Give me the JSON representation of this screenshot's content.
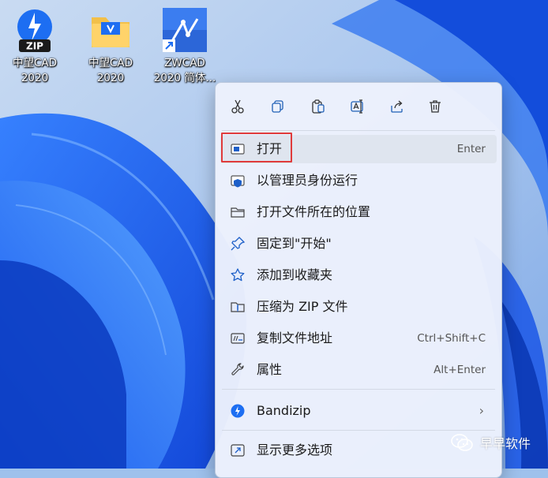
{
  "desktop": {
    "icons": [
      {
        "name": "zip-app",
        "label": "中望CAD\n2020"
      },
      {
        "name": "folder",
        "label": "中望CAD\n2020"
      },
      {
        "name": "zwcad-shortcut",
        "label": "ZWCAD\n2020 简体..."
      }
    ]
  },
  "context_menu": {
    "toolbar": [
      {
        "icon": "cut-icon"
      },
      {
        "icon": "copy-icon"
      },
      {
        "icon": "paste-icon"
      },
      {
        "icon": "rename-icon"
      },
      {
        "icon": "share-icon"
      },
      {
        "icon": "delete-icon"
      }
    ],
    "items": [
      {
        "label": "打开",
        "shortcut": "Enter",
        "icon": "open-window-icon"
      },
      {
        "label": "以管理员身份运行",
        "shortcut": "",
        "icon": "shield-icon"
      },
      {
        "label": "打开文件所在的位置",
        "shortcut": "",
        "icon": "folder-icon"
      },
      {
        "label": "固定到\"开始\"",
        "shortcut": "",
        "icon": "pin-icon"
      },
      {
        "label": "添加到收藏夹",
        "shortcut": "",
        "icon": "star-icon"
      },
      {
        "label": "压缩为 ZIP 文件",
        "shortcut": "",
        "icon": "zip-icon"
      },
      {
        "label": "复制文件地址",
        "shortcut": "Ctrl+Shift+C",
        "icon": "copy-path-icon"
      },
      {
        "label": "属性",
        "shortcut": "Alt+Enter",
        "icon": "wrench-icon"
      },
      {
        "label": "Bandizip",
        "shortcut": "",
        "icon": "bandizip-icon"
      },
      {
        "label": "显示更多选项",
        "shortcut": "",
        "icon": "more-options-icon"
      }
    ]
  },
  "watermark": {
    "text": "早早软件"
  },
  "colors": {
    "accent": "#0067c0",
    "highlight": "#e03b3b"
  }
}
